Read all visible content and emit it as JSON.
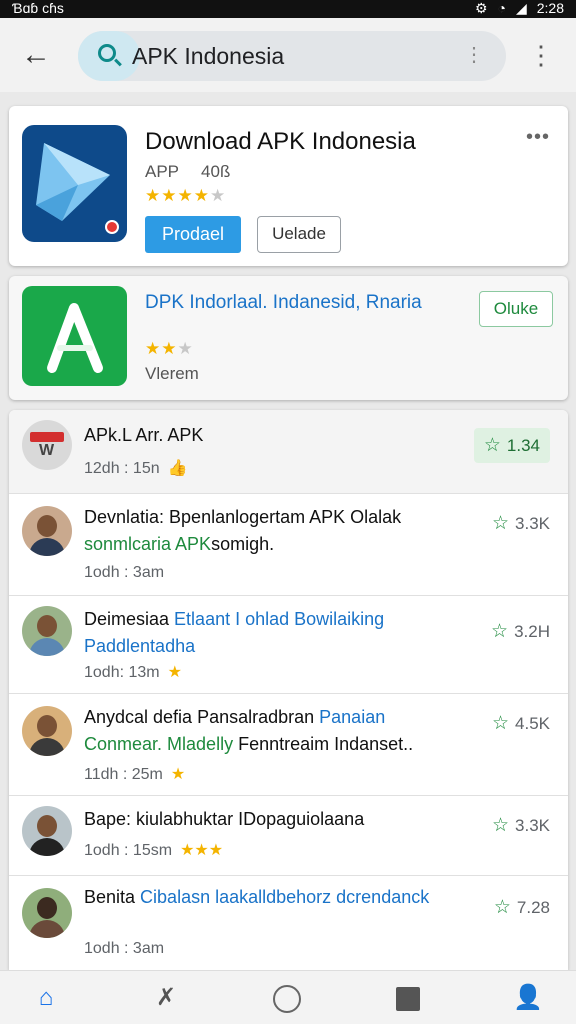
{
  "status_bar": {
    "left_text": "Ɓɑɓ cɦs",
    "time": "2:28"
  },
  "search": {
    "query": "APK Indonesia"
  },
  "featured": {
    "title": "Download APK Indonesia",
    "type_label": "APP",
    "size": "40ß",
    "rating_stars": 4,
    "install_label": "Prodael",
    "update_label": "Uelade"
  },
  "second_app": {
    "title": "DPK Indorlaal. Indanesid, Rnaria",
    "rating_stars": 2,
    "subtitle": "Vlerem",
    "open_label": "Oluke"
  },
  "list": [
    {
      "title_parts": [
        {
          "t": "APk.L Arr. APK",
          "c": ""
        }
      ],
      "meta": "12dh : 15n",
      "extra": "👍",
      "rating": "1.34"
    },
    {
      "title_parts": [
        {
          "t": "Devnlatia: Bpenlanlogertam APK Olalak ",
          "c": ""
        },
        {
          "t": "sonmlcaria APK",
          "c": "g"
        },
        {
          "t": "somigh.",
          "c": ""
        }
      ],
      "meta": "1odh : 3am",
      "extra": "",
      "rating": "3.3K"
    },
    {
      "title_parts": [
        {
          "t": "Deimesiaa ",
          "c": ""
        },
        {
          "t": "Etlaant I ohlad Bowilaiking Paddlentadha",
          "c": "b"
        }
      ],
      "meta": "1odh: 13m",
      "extra": "★",
      "rating": "3.2H"
    },
    {
      "title_parts": [
        {
          "t": "Anydcal defia Pansalradbran ",
          "c": ""
        },
        {
          "t": "Panaian ",
          "c": "b"
        },
        {
          "t": "Conmear. Mladelly ",
          "c": "g"
        },
        {
          "t": "Fenntreaim Indanset..",
          "c": ""
        }
      ],
      "meta": "11dh : 25m",
      "extra": "★",
      "rating": "4.5K"
    },
    {
      "title_parts": [
        {
          "t": "Bape: kiulabhuktar IDopaguiolaana",
          "c": ""
        }
      ],
      "meta": "1odh : 15sm",
      "extra": "★★★",
      "rating": "3.3K"
    },
    {
      "title_parts": [
        {
          "t": "Benita ",
          "c": ""
        },
        {
          "t": "Cibalasn laakalldbehorz dcrendanck",
          "c": "b"
        }
      ],
      "meta": "1odh : 3am",
      "extra": "",
      "rating": "7.28"
    }
  ],
  "colors": {
    "accent": "#2d9be4",
    "green": "#1e8a3d",
    "link": "#1a73c8",
    "star": "#f4b400"
  }
}
